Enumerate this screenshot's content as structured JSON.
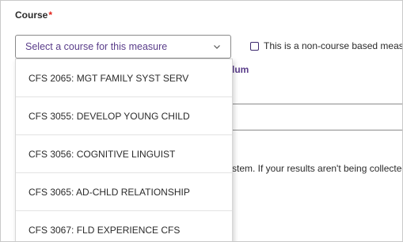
{
  "course_field": {
    "label": "Course",
    "required_marker": "*",
    "placeholder": "Select a course for this measure"
  },
  "non_course_checkbox": {
    "label": "This is a non-course based measure",
    "checked": false
  },
  "background_fragments": {
    "curriculum_partial": "lum",
    "system_text_partial": "system. If your results aren't being collected"
  },
  "dropdown": {
    "options": [
      "CFS 2065: MGT FAMILY SYST SERV",
      "CFS 3055: DEVELOP YOUNG CHILD",
      "CFS 3056: COGNITIVE LINGUIST",
      "CFS 3065: AD-CHLD RELATIONSHIP",
      "CFS 3067: FLD EXPERIENCE CFS"
    ]
  },
  "icons": {
    "select_chevron": "chevron-down-icon"
  },
  "colors": {
    "required": "#e2231a",
    "accent_purple": "#5a3d8a",
    "checkbox_border": "#3d2a6e"
  }
}
